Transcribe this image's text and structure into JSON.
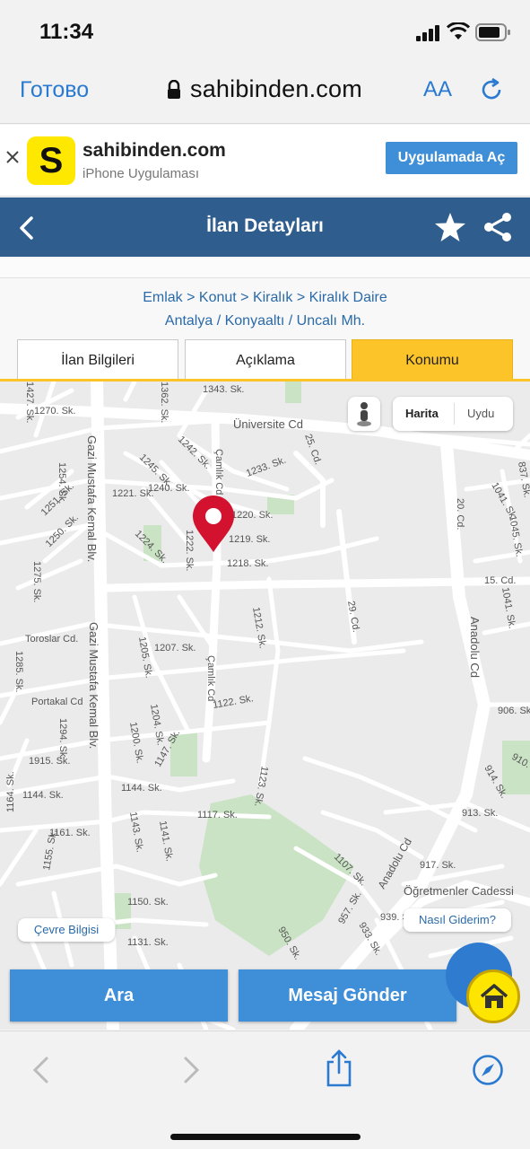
{
  "status_bar": {
    "time": "11:34"
  },
  "browser": {
    "done_label": "Готово",
    "url": "sahibinden.com",
    "text_size_label": "AA"
  },
  "app_banner": {
    "app_name": "sahibinden.com",
    "platform": "iPhone Uygulaması",
    "logo_letter": "S",
    "open_button": "Uygulamada Aç"
  },
  "header": {
    "title": "İlan Detayları"
  },
  "breadcrumb": {
    "category_path": "Emlak > Konut > Kiralık > Kiralık Daire",
    "location_path": "Antalya / Konyaaltı / Uncalı Mh."
  },
  "tabs": [
    {
      "label": "İlan Bilgileri",
      "active": false
    },
    {
      "label": "Açıklama",
      "active": false
    },
    {
      "label": "Konumu",
      "active": true
    }
  ],
  "map": {
    "type_options": [
      "Harita",
      "Uydu"
    ],
    "selected_type": "Harita",
    "env_info_label": "Çevre Bilgisi",
    "directions_label": "Nasıl Giderim?",
    "streets": [
      "Üniversite Cd",
      "Gazi Mustafa Kemal Blv.",
      "Anadolu Cd",
      "Çamlık Cd",
      "Öğretmenler Cadessi",
      "Toroslar Cd.",
      "Portakal Cd",
      "20. Cd.",
      "15. Cd.",
      "25. Cd.",
      "29. Cd.",
      "1343. Sk.",
      "1270. Sk.",
      "1233. Sk.",
      "1221. Sk.",
      "1240. Sk.",
      "1220. Sk.",
      "1219. Sk.",
      "1218. Sk.",
      "1207. Sk.",
      "1122. Sk.",
      "1212. Sk.",
      "1144. Sk.",
      "1117. Sk.",
      "1161. Sk.",
      "1150. Sk.",
      "1131. Sk.",
      "1107. Sk.",
      "1123. Sk.",
      "1147. Sk.",
      "1200. Sk.",
      "1204. Sk.",
      "1205. Sk.",
      "1915. Sk.",
      "1285. Sk.",
      "1294. Sk.",
      "1275. Sk.",
      "1250. Sk.",
      "1251. Sk.",
      "1254. Sk.",
      "1224. Sk.",
      "1222. Sk.",
      "1245. Sk.",
      "1242. Sk.",
      "1041. Sk.",
      "1045. Sk.",
      "906. Sk.",
      "910. Sk.",
      "913. Sk.",
      "914. Sk.",
      "917. Sk.",
      "939. Sk.",
      "950. Sk.",
      "957. Sk.",
      "933. Sk.",
      "1143. Sk.",
      "1141. Sk.",
      "1155. Sk.",
      "1164. Sk.",
      "1362. Sk.",
      "1427. Sk.",
      "837. Sk."
    ]
  },
  "actions": {
    "call_label": "Ara",
    "message_label": "Mesaj Gönder"
  },
  "colors": {
    "header_blue": "#2f5d8d",
    "action_blue": "#3f8fd8",
    "tab_active": "#fdc42a",
    "pin_red": "#d3122f"
  }
}
